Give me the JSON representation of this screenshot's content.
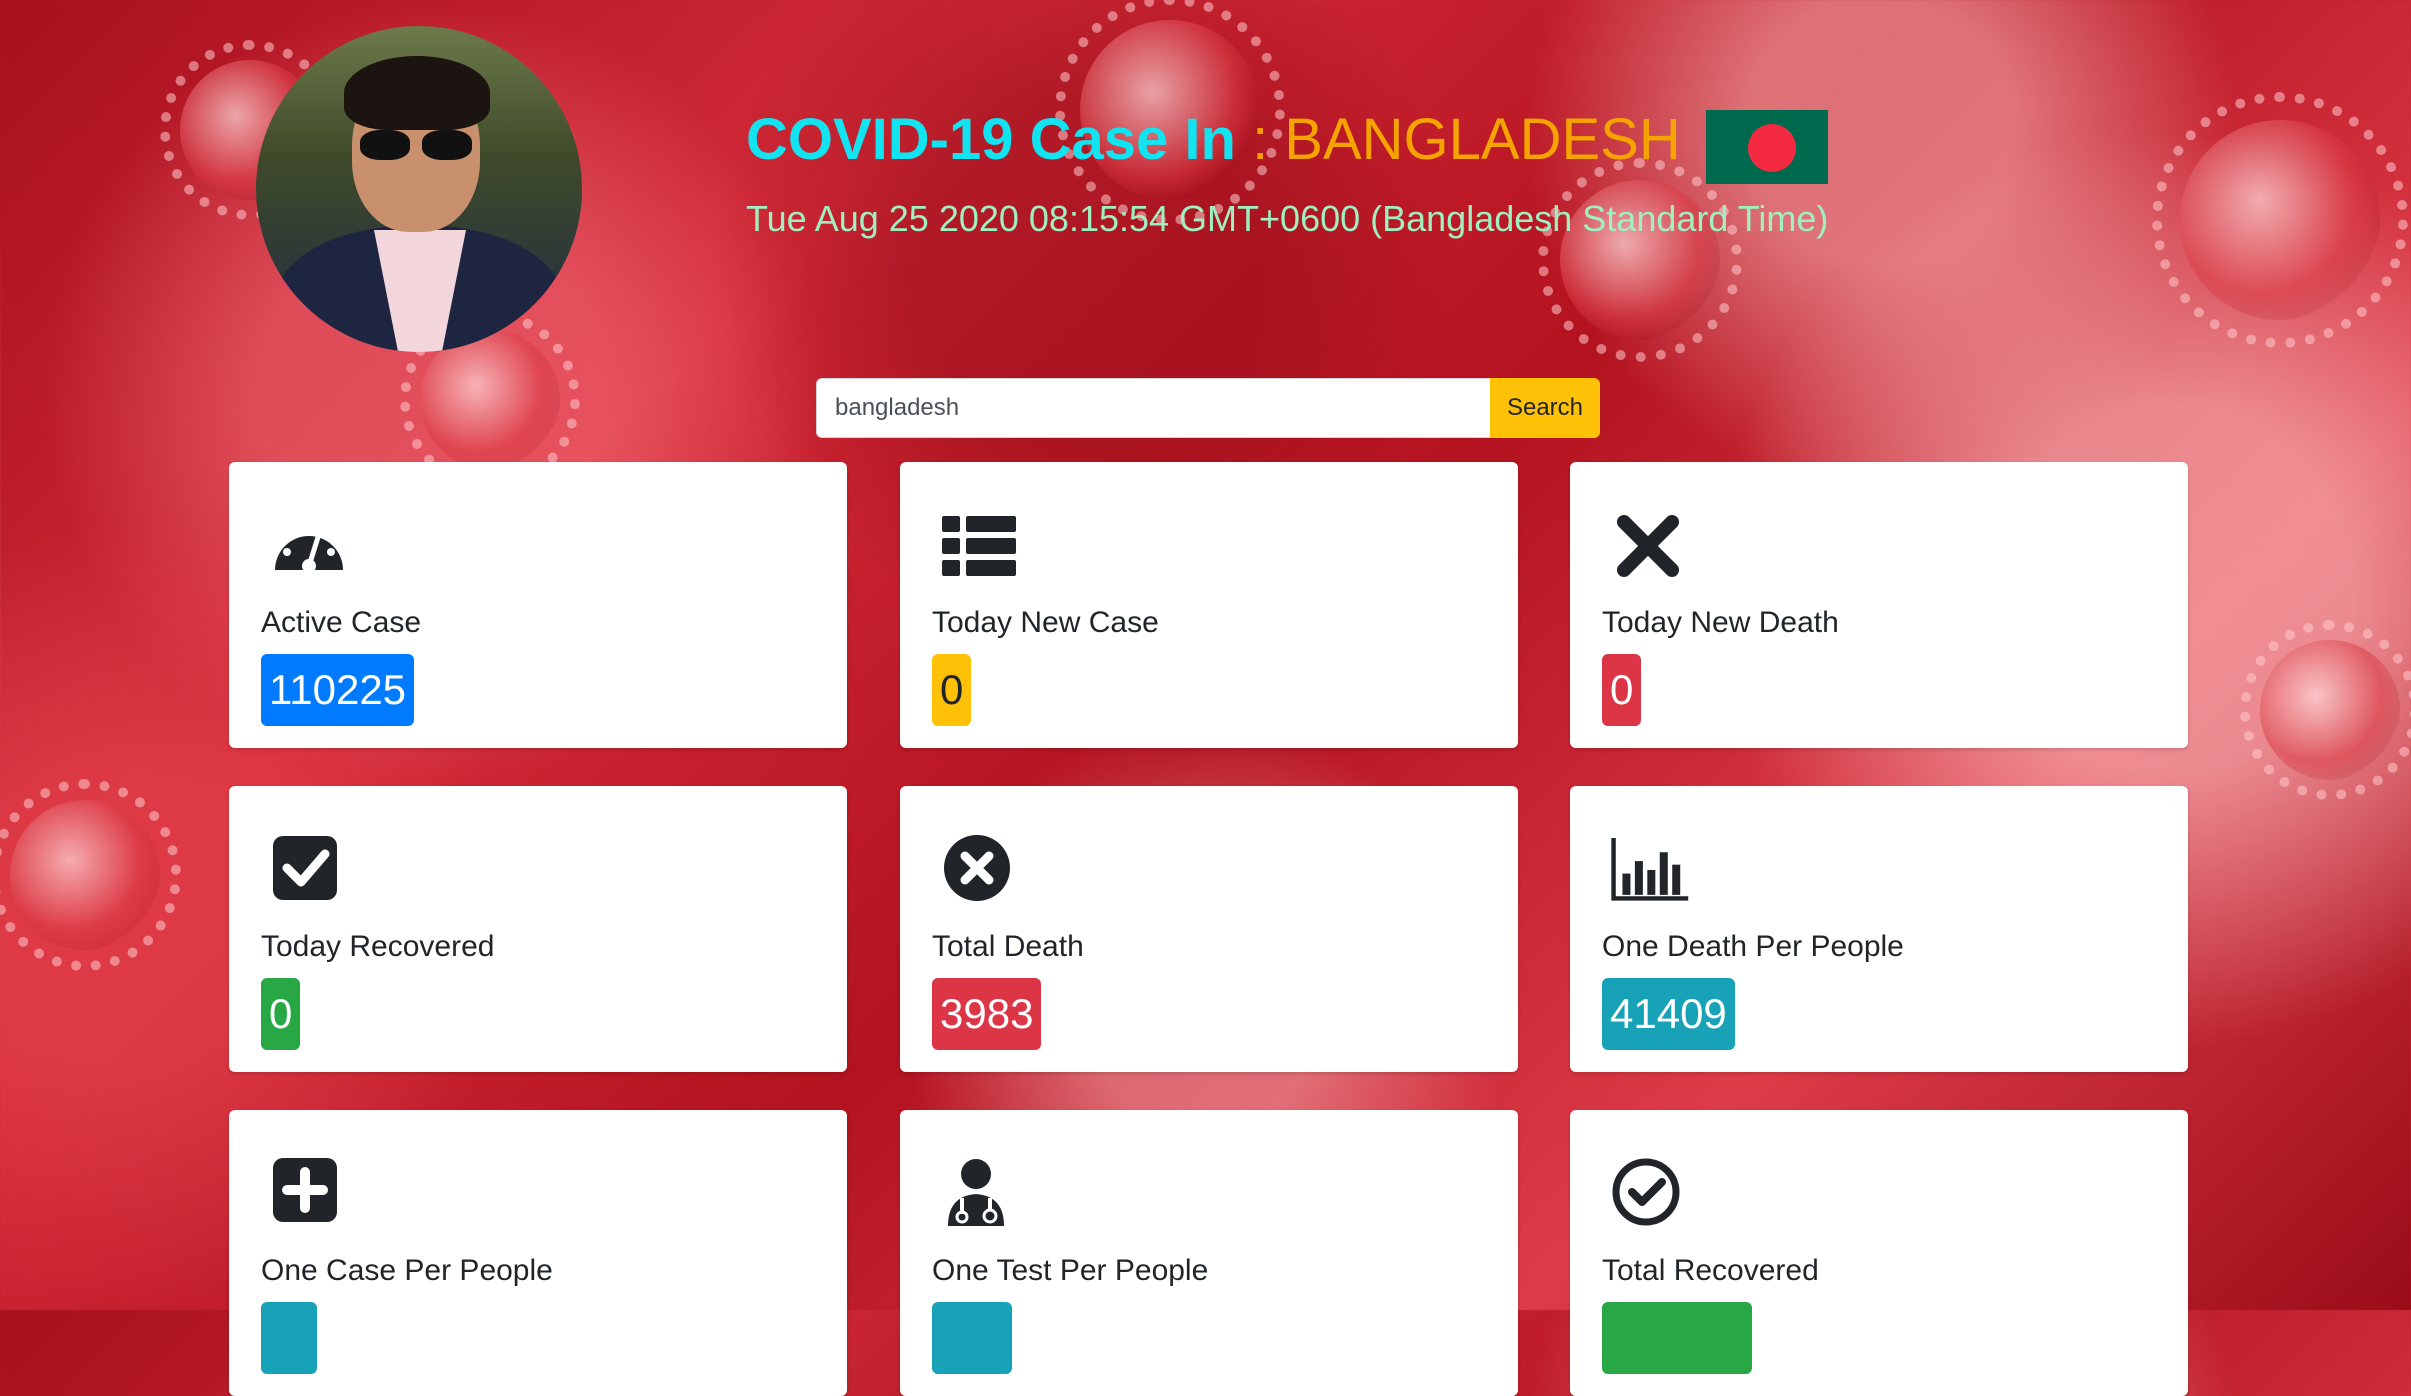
{
  "header": {
    "title_prefix": "COVID-19 Case In",
    "title_sep": " : ",
    "country": "BANGLADESH",
    "datetime": "Tue Aug 25 2020 08:15:54 GMT+0600 (Bangladesh Standard Time)"
  },
  "search": {
    "value": "bangladesh",
    "button_label": "Search"
  },
  "colors": {
    "title_cyan": "#12e3f0",
    "country_orange": "#f5a300",
    "primary": "#007bff",
    "warning": "#ffc107",
    "danger": "#dc3545",
    "success": "#28a745",
    "info": "#17a2b8"
  },
  "cards": [
    {
      "label": "Active Case",
      "value": "110225",
      "icon": "tachometer-icon",
      "color": "#007bff"
    },
    {
      "label": "Today New Case",
      "value": "0",
      "icon": "list-icon",
      "color": "#ffc107"
    },
    {
      "label": "Today New Death",
      "value": "0",
      "icon": "x-mark-icon",
      "color": "#dc3545"
    },
    {
      "label": "Today Recovered",
      "value": "0",
      "icon": "check-square-icon",
      "color": "#28a745"
    },
    {
      "label": "Total Death",
      "value": "3983",
      "icon": "times-circle-icon",
      "color": "#dc3545"
    },
    {
      "label": "One Death Per People",
      "value": "41409",
      "icon": "bar-chart-icon",
      "color": "#17a2b8"
    },
    {
      "label": "One Case Per People",
      "value": "",
      "icon": "plus-square-icon",
      "color": "#17a2b8"
    },
    {
      "label": "One Test Per People",
      "value": "",
      "icon": "user-doctor-icon",
      "color": "#17a2b8"
    },
    {
      "label": "Total Recovered",
      "value": "",
      "icon": "check-circle-icon",
      "color": "#28a745"
    }
  ]
}
